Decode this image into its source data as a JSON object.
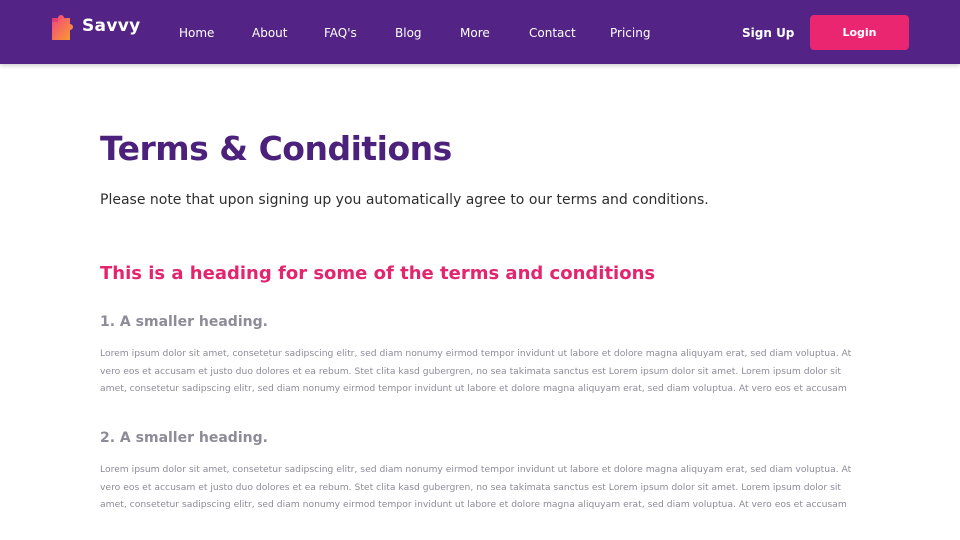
{
  "brand": {
    "name": "Savvy",
    "logo_icon": "puzzle-logo-icon",
    "colors": {
      "nav_bg": "#532485",
      "accent": "#eb2671",
      "title": "#4b217c",
      "muted": "#8e8b99"
    }
  },
  "nav": {
    "links": [
      "Home",
      "About",
      "FAQ's",
      "Blog",
      "More",
      "Contact",
      "Pricing"
    ],
    "signup_label": "Sign Up",
    "login_label": "Login"
  },
  "page": {
    "title": "Terms & Conditions",
    "intro": "Please note that upon signing up you automatically agree to our terms and conditions.",
    "section_heading": "This is a heading for some of the terms and conditions",
    "subsections": [
      {
        "heading": "1. A smaller heading.",
        "text": "Lorem ipsum dolor sit amet, consetetur sadipscing elitr, sed diam nonumy eirmod tempor invidunt ut labore et dolore magna aliquyam erat, sed diam voluptua. At vero eos et accusam et justo duo dolores et ea rebum. Stet clita kasd gubergren, no sea takimata sanctus est Lorem ipsum dolor sit amet. Lorem ipsum dolor sit amet, consetetur sadipscing elitr, sed diam nonumy eirmod tempor invidunt ut labore et dolore magna aliquyam erat, sed diam voluptua. At vero eos et accusam"
      },
      {
        "heading": "2. A smaller heading.",
        "text": "Lorem ipsum dolor sit amet, consetetur sadipscing elitr, sed diam nonumy eirmod tempor invidunt ut labore et dolore magna aliquyam erat, sed diam voluptua. At vero eos et accusam et justo duo dolores et ea rebum. Stet clita kasd gubergren, no sea takimata sanctus est Lorem ipsum dolor sit amet. Lorem ipsum dolor sit amet, consetetur sadipscing elitr, sed diam nonumy eirmod tempor invidunt ut labore et dolore magna aliquyam erat, sed diam voluptua. At vero eos et accusam"
      }
    ]
  }
}
